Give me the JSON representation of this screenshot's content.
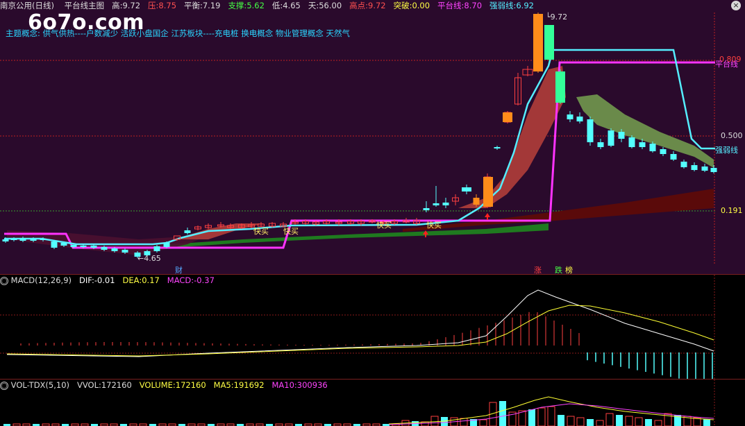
{
  "header": {
    "stock_name": "南京公用(日线)",
    "indicator": "平台线主图",
    "high_label": "高:",
    "high": "9.72",
    "pressure_label": "压:",
    "pressure": "8.75",
    "balance_label": "平衡:",
    "balance": "7.19",
    "support_label": "支撑:",
    "support": "5.62",
    "low_label": "低:",
    "low": "4.65",
    "days_label": "天:",
    "days": "56.00",
    "peak_label": "高点:",
    "peak": "9.72",
    "breakout_label": "突破:",
    "breakout": "0.00",
    "platform_label": "平台线:",
    "platform": "8.70",
    "strength_label": "强弱线:",
    "strength": "6.92"
  },
  "watermark": "6o7o.com",
  "concepts": "主题概念:  供气供热----户数减少 活跃小盘国企 江苏板块----充电桩 换电概念 物业管理概念 天然气",
  "price_labels": {
    "high_mark": "9.72",
    "low_mark": "4.65",
    "level_top": "0.809",
    "level_mid": "0.500",
    "level_bot": "0.191",
    "platform_line": "平台线",
    "strength_line": "强弱线"
  },
  "buy_signals": [
    "快买",
    "快买",
    "快买",
    "快买"
  ],
  "bottom_tags": {
    "cai": "财",
    "zhang": "涨",
    "die": "跌",
    "bang": "榜"
  },
  "macd": {
    "title": "MACD(12,26,9)",
    "dif_label": "DIF:",
    "dif": "-0.01",
    "dea_label": "DEA:",
    "dea": "0.17",
    "macd_label": "MACD:",
    "macd": "-0.37"
  },
  "volume": {
    "title": "VOL-TDX(5,10)",
    "vvol_label": "VVOL:",
    "vvol": "172160",
    "volume_label": "VOLUME:",
    "volume": "172160",
    "ma5_label": "MA5:",
    "ma5": "191692",
    "ma10_label": "MA10:",
    "ma10": "300936"
  },
  "colors": {
    "up": "#ff4040",
    "down": "#54ffff",
    "platform": "#ff33ff",
    "strength": "#55eeff",
    "yellow": "#ffff00"
  }
}
